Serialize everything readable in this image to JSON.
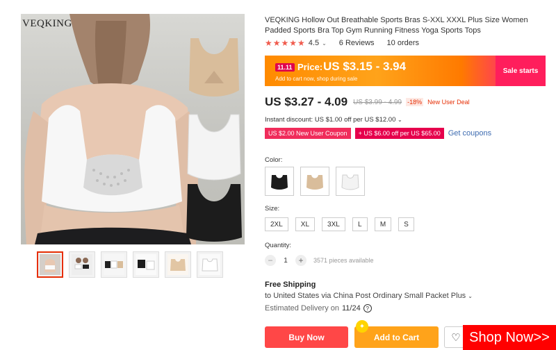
{
  "brand": "VEQKING",
  "product": {
    "title": "VEQKING Hollow Out Breathable Sports Bras S-XXL XXXL Plus Size Women Padded Sports Bra Top Gym Running Fitness Yoga Sports Tops",
    "rating_value": "4.5",
    "reviews": "6 Reviews",
    "orders": "10 orders"
  },
  "promo": {
    "badge": "11.11",
    "label": "Price:",
    "price": "US $3.15 - 3.94",
    "subtext": "Add to cart now, shop during sale",
    "right_label": "Sale starts"
  },
  "price": {
    "current": "US $3.27 - 4.09",
    "original": "US $3.99 - 4.99",
    "discount": "-18%",
    "deal": "New User Deal"
  },
  "instant_discount": "Instant discount: US $1.00 off per US $12.00",
  "coupons": {
    "coupon_a": "US $2.00 New User Coupon",
    "coupon_b": "+ US $6.00 off per US $65.00",
    "get_coupons": "Get coupons"
  },
  "color": {
    "label": "Color:",
    "options": [
      "black",
      "nude",
      "white"
    ]
  },
  "size": {
    "label": "Size:",
    "options": [
      "2XL",
      "XL",
      "3XL",
      "L",
      "M",
      "S"
    ]
  },
  "quantity": {
    "label": "Quantity:",
    "value": "1",
    "available": "3571 pieces available",
    "minus": "−",
    "plus": "+"
  },
  "shipping": {
    "title": "Free Shipping",
    "line": "to United States via China Post Ordinary Small Packet Plus",
    "eta_prefix": "Estimated Delivery on",
    "eta_date": "11/24"
  },
  "actions": {
    "buy_now": "Buy Now",
    "add_to_cart": "Add to Cart",
    "shop_now": "Shop Now>>"
  },
  "thumbnails": [
    "back-view",
    "two-models",
    "three-colors",
    "black-white",
    "nude-flat",
    "white-flat"
  ],
  "colors": {
    "accent": "#e62e04",
    "star": "#f05b4d",
    "buy": "#ff4747",
    "cart": "#ffa31a",
    "promo_pink": "#ff1e5c",
    "link": "#3d6bb0"
  }
}
